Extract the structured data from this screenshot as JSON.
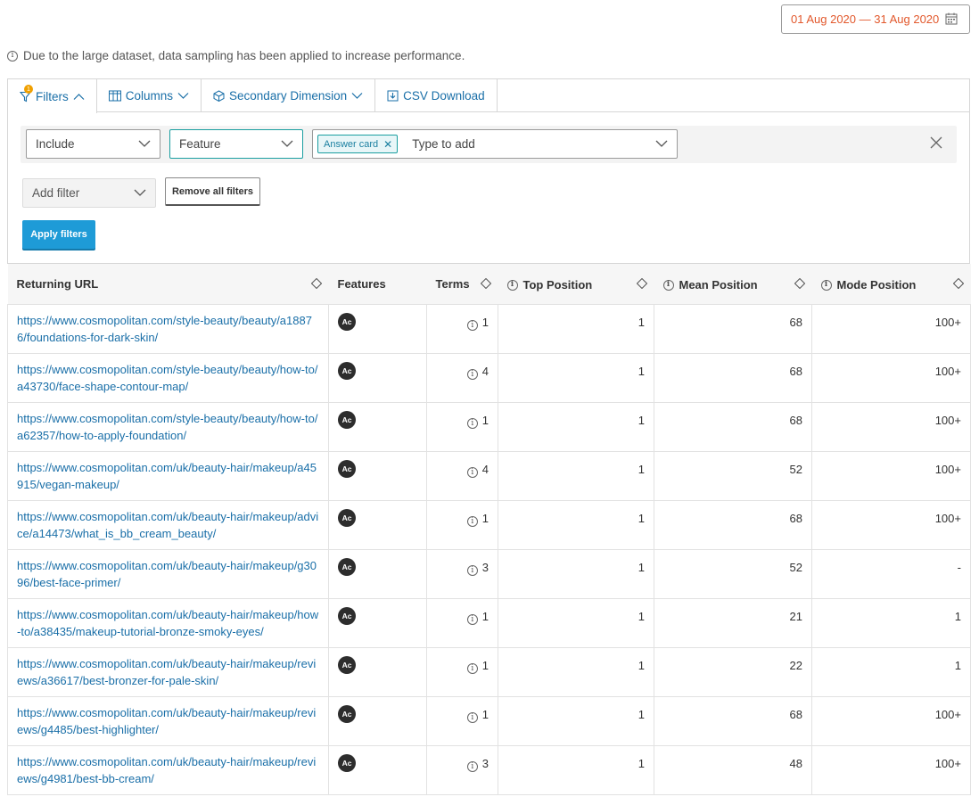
{
  "date_range": "01 Aug 2020 — 31 Aug 2020",
  "notice": "Due to the large dataset, data sampling has been applied to increase performance.",
  "tabs": {
    "filters": "Filters",
    "filters_badge": "1",
    "columns": "Columns",
    "secondary_dimension": "Secondary Dimension",
    "csv_download": "CSV Download"
  },
  "filter": {
    "include": "Include",
    "feature": "Feature",
    "chip": "Answer card",
    "type_placeholder": "Type to add",
    "add_filter": "Add filter",
    "remove_all": "Remove all filters",
    "apply": "Apply filters"
  },
  "table": {
    "headers": {
      "url": "Returning URL",
      "features": "Features",
      "terms": "Terms",
      "top": "Top Position",
      "mean": "Mean Position",
      "mode": "Mode Position"
    },
    "feature_badge": "Ac",
    "rows": [
      {
        "url": "https://www.cosmopolitan.com/style-beauty/beauty/a18876/foundations-for-dark-skin/",
        "terms": "1",
        "top": "1",
        "mean": "68",
        "mode": "100+"
      },
      {
        "url": "https://www.cosmopolitan.com/style-beauty/beauty/how-to/a43730/face-shape-contour-map/",
        "terms": "4",
        "top": "1",
        "mean": "68",
        "mode": "100+"
      },
      {
        "url": "https://www.cosmopolitan.com/style-beauty/beauty/how-to/a62357/how-to-apply-foundation/",
        "terms": "1",
        "top": "1",
        "mean": "68",
        "mode": "100+"
      },
      {
        "url": "https://www.cosmopolitan.com/uk/beauty-hair/makeup/a45915/vegan-makeup/",
        "terms": "4",
        "top": "1",
        "mean": "52",
        "mode": "100+"
      },
      {
        "url": "https://www.cosmopolitan.com/uk/beauty-hair/makeup/advice/a14473/what_is_bb_cream_beauty/",
        "terms": "1",
        "top": "1",
        "mean": "68",
        "mode": "100+"
      },
      {
        "url": "https://www.cosmopolitan.com/uk/beauty-hair/makeup/g3096/best-face-primer/",
        "terms": "3",
        "top": "1",
        "mean": "52",
        "mode": "-"
      },
      {
        "url": "https://www.cosmopolitan.com/uk/beauty-hair/makeup/how-to/a38435/makeup-tutorial-bronze-smoky-eyes/",
        "terms": "1",
        "top": "1",
        "mean": "21",
        "mode": "1"
      },
      {
        "url": "https://www.cosmopolitan.com/uk/beauty-hair/makeup/reviews/a36617/best-bronzer-for-pale-skin/",
        "terms": "1",
        "top": "1",
        "mean": "22",
        "mode": "1"
      },
      {
        "url": "https://www.cosmopolitan.com/uk/beauty-hair/makeup/reviews/g4485/best-highlighter/",
        "terms": "1",
        "top": "1",
        "mean": "68",
        "mode": "100+"
      },
      {
        "url": "https://www.cosmopolitan.com/uk/beauty-hair/makeup/reviews/g4981/best-bb-cream/",
        "terms": "3",
        "top": "1",
        "mean": "48",
        "mode": "100+"
      }
    ]
  },
  "colors": {
    "link": "#1a6fa8",
    "date_text": "#e2582c",
    "apply_button": "#1e9bd7",
    "chip_border": "#1a9ea0",
    "badge": "#f0a000"
  }
}
